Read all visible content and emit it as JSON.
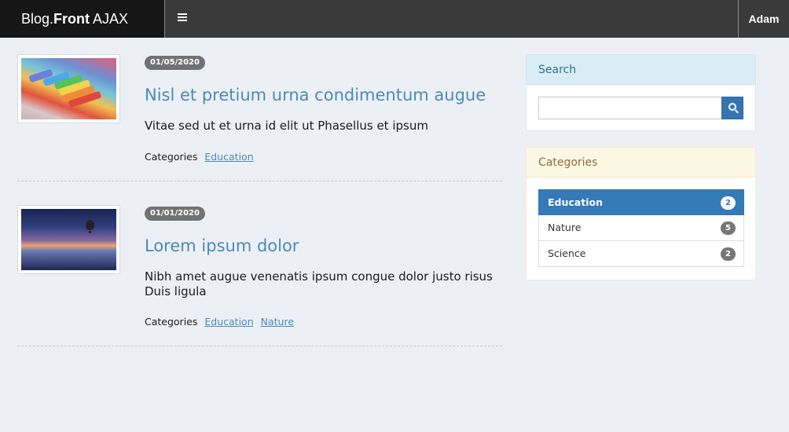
{
  "header": {
    "brand_prefix": "Blog.",
    "brand_bold": "Front",
    "brand_suffix": " AJAX",
    "menu_icon": "hamburger-icon",
    "user_name": "Adam"
  },
  "posts": [
    {
      "date": "01/05/2020",
      "title": "Nisl et pretium urna condimentum augue",
      "excerpt": "Vitae sed ut et urna id elit ut Phasellus et ipsum",
      "categories_label": "Categories",
      "categories": [
        "Education"
      ],
      "thumbnail": "colorful-chalk-image"
    },
    {
      "date": "01/01/2020",
      "title": "Lorem ipsum dolor",
      "excerpt": "Nibh amet augue venenatis ipsum congue dolor justo risus Duis ligula",
      "categories_label": "Categories",
      "categories": [
        "Education",
        "Nature"
      ],
      "thumbnail": "hot-air-balloon-sunset-image"
    }
  ],
  "sidebar": {
    "search": {
      "heading": "Search",
      "placeholder": "",
      "value": "",
      "button_icon": "search-icon"
    },
    "categories": {
      "heading": "Categories",
      "items": [
        {
          "label": "Education",
          "count": "2",
          "active": true
        },
        {
          "label": "Nature",
          "count": "5",
          "active": false
        },
        {
          "label": "Science",
          "count": "2",
          "active": false
        }
      ]
    }
  },
  "colors": {
    "topbar": "#3a3a3a",
    "brand_bg": "#161616",
    "link": "#4a8ab8",
    "active": "#337ab7",
    "search_heading_bg": "#d9edf7",
    "categories_heading_bg": "#fcf8e3"
  }
}
